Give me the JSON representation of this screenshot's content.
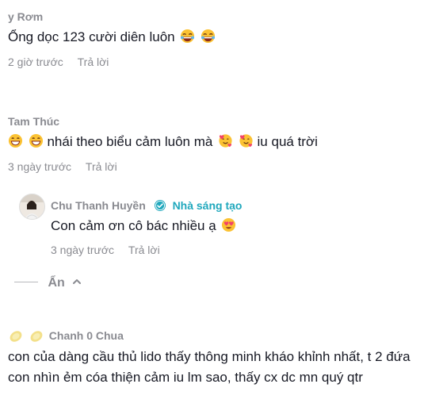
{
  "comments": [
    {
      "author": "y Rơm",
      "text": "Ổng dọc 123 cười diên luôn",
      "emoji": [
        "rolling-laugh-emoji",
        "rolling-laugh-emoji"
      ],
      "time": "2 giờ trước",
      "reply_label": "Trả lời"
    },
    {
      "author": "Tam Thúc",
      "text_before": "nhái theo biểu cảm luôn mà",
      "text_after": "iu quá trời",
      "time": "3 ngày trước",
      "reply_label": "Trả lời",
      "reply": {
        "author": "Chu Thanh Huyền",
        "creator_badge": "Nhà sáng tạo",
        "text": "Con cảm ơn cô bác nhiều ạ",
        "time": "3 ngày trước",
        "reply_label": "Trả lời"
      },
      "collapse_label": "Ẩn"
    },
    {
      "author": "Chanh 0 Chua",
      "text": "con của dàng cầu thủ lido thấy thông minh kháo khỉnh nhất, t 2 đứa con nhìn ẻm cóa thiện cảm iu lm sao, thấy cx dc mn quý qtr"
    }
  ],
  "colors": {
    "meta": "#8a8b91",
    "text": "#161823",
    "creator": "#20a8bd"
  }
}
